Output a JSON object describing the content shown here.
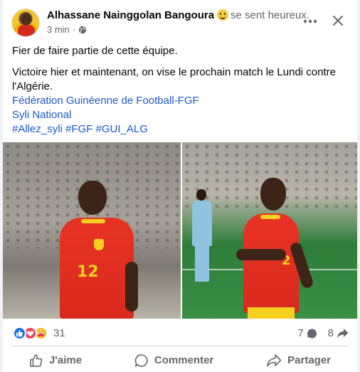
{
  "post": {
    "author": "Alhassane Nainggolan Bangoura",
    "feeling": "se sent heureux.",
    "time": "3 min",
    "separator": "·",
    "text": {
      "line1": "Fier de faire partie de cette équipe.",
      "line2": "Victoire hier et maintenant, on vise le prochain match le Lundi contre l'Algérie.",
      "tag1": "Fédération Guinéenne de Football-FGF",
      "tag2": "Syli National",
      "hashtags": "#Allez_syli #FGF #GUI_ALG"
    },
    "photos": [
      {
        "jersey_number": "12"
      },
      {
        "jersey_number": "2"
      }
    ],
    "reactions": {
      "types": [
        "like-icon",
        "love-icon",
        "care-icon"
      ],
      "count": "31"
    },
    "comments_count": "7",
    "shares_count": "8"
  },
  "actions": {
    "like": "J'aime",
    "comment": "Commenter",
    "share": "Partager"
  },
  "colors": {
    "link": "#1b59c7",
    "like": "#1b74e4",
    "love": "#f33e58",
    "care": "#f7b125",
    "jersey_red": "#e73324",
    "jersey_yellow": "#f5d020"
  }
}
